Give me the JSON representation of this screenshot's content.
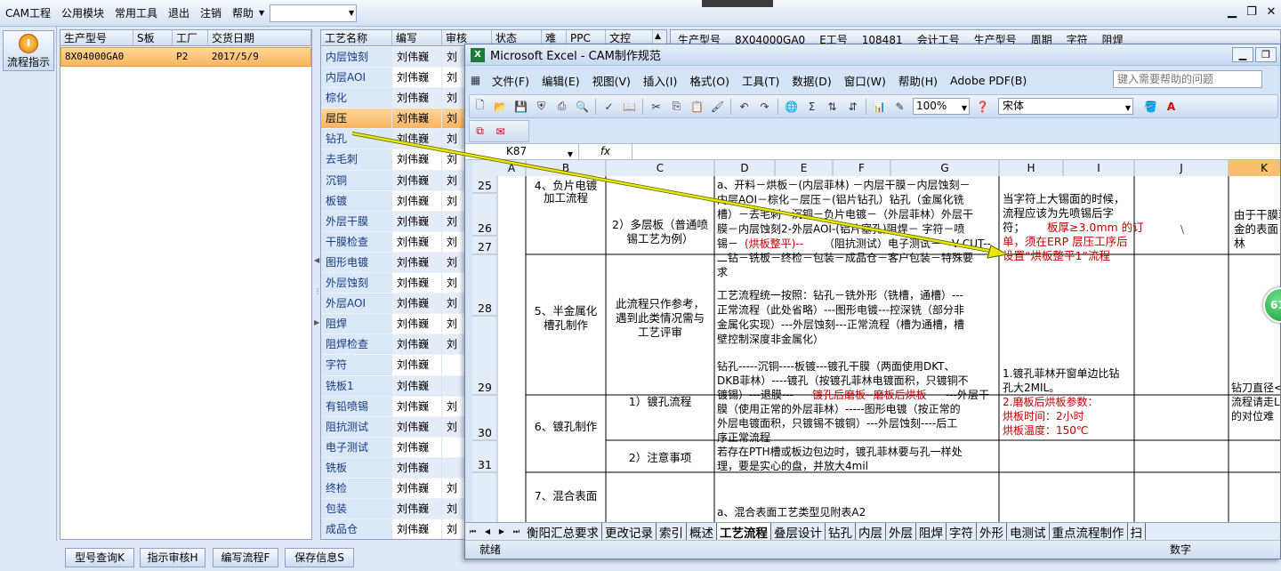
{
  "menubar": {
    "items": [
      "CAM工程",
      "公用模块",
      "常用工具",
      "退出",
      "注销",
      "帮助"
    ],
    "combo_value": ""
  },
  "lefttool": {
    "flow_button": "流程指示",
    "flow_icon": "I"
  },
  "orders": {
    "headers": [
      "生产型号",
      "S板",
      "工厂",
      "交货日期"
    ],
    "rows": [
      [
        "8X04000GA0",
        "",
        "P2",
        "2017/5/9"
      ]
    ]
  },
  "process": {
    "headers": [
      "工艺名称",
      "编写",
      "审核",
      "状态",
      "难",
      "PPC",
      "文控"
    ],
    "rows": [
      [
        "内层蚀刻",
        "刘伟巍",
        "刘"
      ],
      [
        "内层AOI",
        "刘伟巍",
        "刘"
      ],
      [
        "棕化",
        "刘伟巍",
        "刘"
      ],
      [
        "层压",
        "刘伟巍",
        "刘"
      ],
      [
        "钻孔",
        "刘伟巍",
        "刘"
      ],
      [
        "去毛刺",
        "刘伟巍",
        "刘"
      ],
      [
        "沉铜",
        "刘伟巍",
        "刘"
      ],
      [
        "板镀",
        "刘伟巍",
        "刘"
      ],
      [
        "外层干膜",
        "刘伟巍",
        "刘"
      ],
      [
        "干膜检查",
        "刘伟巍",
        "刘"
      ],
      [
        "图形电镀",
        "刘伟巍",
        "刘"
      ],
      [
        "外层蚀刻",
        "刘伟巍",
        "刘"
      ],
      [
        "外层AOI",
        "刘伟巍",
        "刘"
      ],
      [
        "阻焊",
        "刘伟巍",
        "刘"
      ],
      [
        "阻焊检查",
        "刘伟巍",
        "刘"
      ],
      [
        "字符",
        "刘伟巍",
        ""
      ],
      [
        "铣板1",
        "刘伟巍",
        ""
      ],
      [
        "有铅喷锡",
        "刘伟巍",
        "刘"
      ],
      [
        "阻抗测试",
        "刘伟巍",
        "刘"
      ],
      [
        "电子测试",
        "刘伟巍",
        ""
      ],
      [
        "铣板",
        "刘伟巍",
        ""
      ],
      [
        "终检",
        "刘伟巍",
        "刘"
      ],
      [
        "包装",
        "刘伟巍",
        "刘"
      ],
      [
        "成品仓",
        "刘伟巍",
        "刘"
      ]
    ],
    "selected_index": 3
  },
  "right_panel": {
    "labels": [
      "生产型号",
      "8X04000GA0",
      "E工号",
      "108481",
      "会计工号",
      "生产型号",
      "周期",
      "字符",
      "阻焊"
    ]
  },
  "bottom_buttons": [
    "型号查询K",
    "指示审核H",
    "编写流程F",
    "保存信息S"
  ],
  "excel": {
    "title": "Microsoft Excel - CAM制作规范",
    "menu": [
      "文件(F)",
      "编辑(E)",
      "视图(V)",
      "插入(I)",
      "格式(O)",
      "工具(T)",
      "数据(D)",
      "窗口(W)",
      "帮助(H)",
      "Adobe PDF(B)"
    ],
    "help_placeholder": "键入需要帮助的问题",
    "zoom": "100%",
    "font": "宋体",
    "namebox": "K87",
    "fx": "fx",
    "columns": [
      "A",
      "B",
      "C",
      "D",
      "E",
      "F",
      "G",
      "H",
      "I",
      "J",
      "K"
    ],
    "rows": [
      "25",
      "26",
      "27",
      "28",
      "29",
      "30",
      "31"
    ],
    "cells": {
      "b25": [
        "4、负片电镀",
        "加工流程"
      ],
      "c25": [
        "2）多层板（普通喷",
        "锡工艺为例）"
      ],
      "d25_pre": [
        "a、开料－烘板－(内层菲林) －内层干膜－内层蚀刻－",
        "内层AOI－棕化－层压－(铝片钻孔）钻孔（金属化铣",
        "槽）－去毛刺－沉铜－负片电镀－（外层菲林）外层干",
        "膜－内层蚀刻2-外层AOI-(铝片塞孔)阻焊－ 字符－喷",
        "锡－"
      ],
      "d25_red": "(烘板整平)--",
      "d25_post": [
        "（阻抗测试）电子测试－－V-CUT--",
        "二钻－铣板－终检－包装－成品仓－客户包装－特殊要",
        "求"
      ],
      "i25_pre": [
        "当字符上大锡面的时候，",
        "流程应该为先喷锡后字",
        "符；"
      ],
      "i25_red_a": "板厚≥3.0mm 的订",
      "i25_red": [
        "单，须在ERP 层压工序后",
        "设置“烘板整平1”流程"
      ],
      "j25": "\\",
      "k25": [
        "由于干膜菲",
        "金的表面",
        "林"
      ],
      "b28": [
        "5、半金属化",
        "槽孔制作"
      ],
      "c28": [
        "此流程只作参考，",
        "遇到此类情况需与",
        "工艺评审"
      ],
      "d28": [
        "工艺流程统一按照：钻孔－铣外形（铣槽，通槽）---",
        "正常流程（此处省略）---图形电镀---控深铣（部分非",
        "金属化实现）---外层蚀刻---正常流程（槽为通槽，槽",
        "壁控制深度非金属化）"
      ],
      "b29": "6、镀孔制作",
      "c29": "1）镀孔流程",
      "d29_a": "钻孔-----沉铜----板镀---镀孔干膜（两面使用DKT、",
      "d29_b": "DKB菲林）----镀孔（按镀孔菲林电镀面积，只镀铜不",
      "d29_c1": "镀锡）---退膜---",
      "d29_c2": "镀孔后磨板--磨板后烘板",
      "d29_c3": "---外层干",
      "d29_rest": [
        "膜（使用正常的外层菲林）-----图形电镀（按正常的",
        "外层电镀面积，只镀锡不镀铜）---外层蚀刻----后工",
        "序正常流程"
      ],
      "i29_a": [
        "1.镀孔菲林开窗单边比钻",
        "孔大2MIL。"
      ],
      "i29_red": [
        "2.磨板后烘板参数：",
        "烘板时间：2小时",
        "烘板温度：150℃"
      ],
      "k29": [
        "钻刀直径<",
        "流程请走L",
        "的对位难"
      ],
      "c30": "2）注意事项",
      "d30": [
        "若存在PTH槽或板边包边时，镀孔菲林要与孔一样处",
        "理，要是实心的盘，并放大4mil"
      ],
      "b31": "7、混合表面",
      "d31": "a、混合表面工艺类型见附表A2"
    },
    "tabs": [
      "衡阳汇总要求",
      "更改记录",
      "索引",
      "概述",
      "工艺流程",
      "叠层设计",
      "钻孔",
      "内层",
      "外层",
      "阻焊",
      "字符",
      "外形",
      "电测试",
      "重点流程制作",
      "扫"
    ],
    "active_tab": "工艺流程",
    "status_left": "就绪",
    "status_right": "数字",
    "badge": "61"
  },
  "colors": {
    "selection": "#f8b560",
    "red_text": "#c00000",
    "arrow": "#e8e800",
    "active_col": "#f8c070"
  }
}
